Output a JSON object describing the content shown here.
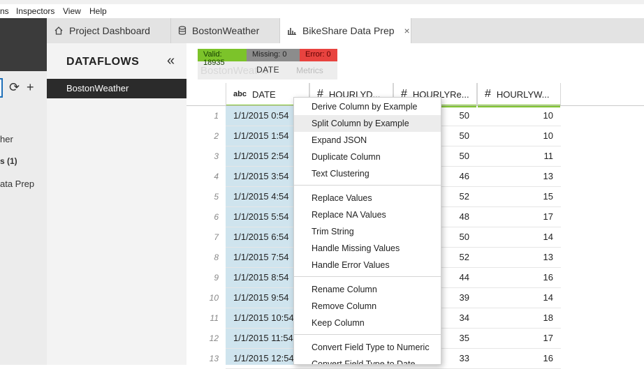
{
  "menubar": {
    "items": [
      "ns",
      "Inspectors",
      "View",
      "Help"
    ]
  },
  "leftpane": {
    "items": [
      "her",
      "s (1)",
      "ata Prep"
    ]
  },
  "tabs": [
    {
      "label": "Project Dashboard",
      "icon": "home-icon"
    },
    {
      "label": "BostonWeather",
      "icon": "database-icon"
    },
    {
      "label": "BikeShare Data Prep",
      "icon": "chart-icon",
      "close": "×"
    }
  ],
  "dataflows": {
    "title": "DATAFLOWS",
    "collapse": "«",
    "selected": "BostonWeather"
  },
  "quality": {
    "valid": "Valid: 18935",
    "missing": "Missing: 0",
    "error": "Error: 0"
  },
  "ghost": {
    "name": "BostonWeather",
    "metrics": "Metrics",
    "date_label": "DATE"
  },
  "columns": [
    {
      "type": "abc",
      "name": "DATE"
    },
    {
      "type": "#",
      "name": "HOURLYD..."
    },
    {
      "type": "#",
      "name": "HOURLYRe..."
    },
    {
      "type": "#",
      "name": "HOURLYW..."
    }
  ],
  "rows": [
    {
      "n": "1",
      "date": "1/1/2015 0:54",
      "v1": "50",
      "v2": "10"
    },
    {
      "n": "2",
      "date": "1/1/2015 1:54",
      "v1": "50",
      "v2": "10"
    },
    {
      "n": "3",
      "date": "1/1/2015 2:54",
      "v1": "50",
      "v2": "11"
    },
    {
      "n": "4",
      "date": "1/1/2015 3:54",
      "v1": "46",
      "v2": "13"
    },
    {
      "n": "5",
      "date": "1/1/2015 4:54",
      "v1": "52",
      "v2": "15"
    },
    {
      "n": "6",
      "date": "1/1/2015 5:54",
      "v1": "48",
      "v2": "17"
    },
    {
      "n": "7",
      "date": "1/1/2015 6:54",
      "v1": "50",
      "v2": "14"
    },
    {
      "n": "8",
      "date": "1/1/2015 7:54",
      "v1": "52",
      "v2": "13"
    },
    {
      "n": "9",
      "date": "1/1/2015 8:54",
      "v1": "44",
      "v2": "16"
    },
    {
      "n": "10",
      "date": "1/1/2015 9:54",
      "v1": "39",
      "v2": "14"
    },
    {
      "n": "11",
      "date": "1/1/2015 10:54",
      "v1": "34",
      "v2": "18"
    },
    {
      "n": "12",
      "date": "1/1/2015 11:54",
      "v1": "35",
      "v2": "17"
    },
    {
      "n": "13",
      "date": "1/1/2015 12:54",
      "v1": "33",
      "v2": "16"
    }
  ],
  "context_menu": {
    "groups": [
      [
        "Derive Column by Example",
        "Split Column by Example",
        "Expand JSON",
        "Duplicate Column",
        "Text Clustering"
      ],
      [
        "Replace Values",
        "Replace NA Values",
        "Trim String",
        "Handle Missing Values",
        "Handle Error Values"
      ],
      [
        "Rename Column",
        "Remove Column",
        "Keep Column"
      ],
      [
        "Convert Field Type to Numeric",
        "Convert Field Type to Date"
      ]
    ],
    "highlighted": "Split Column by Example"
  }
}
